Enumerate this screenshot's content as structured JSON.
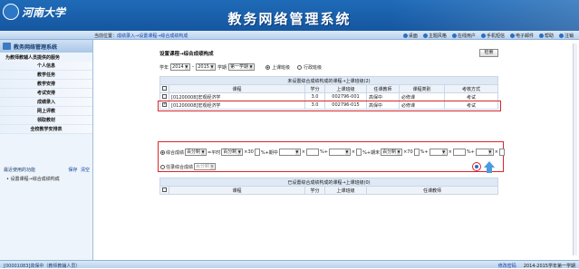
{
  "header": {
    "logo_text": "河南大学",
    "system_title": "教务网络管理系统"
  },
  "breadcrumb": {
    "prefix": "当前位置：",
    "path": "成绩录入→设置课程→综合成绩构成"
  },
  "top_menu": [
    {
      "label": "桌面",
      "icon": "desktop-icon"
    },
    {
      "label": "主题风格",
      "icon": "theme-icon"
    },
    {
      "label": "在线用户",
      "icon": "users-icon"
    },
    {
      "label": "手机短信",
      "icon": "phone-icon"
    },
    {
      "label": "电子邮件",
      "icon": "mail-icon"
    },
    {
      "label": "帮助",
      "icon": "help-icon"
    },
    {
      "label": "注销",
      "icon": "logout-icon"
    }
  ],
  "sidebar": {
    "title": "教务网络管理系统",
    "section": "为教师教辅人员提供的服务",
    "items": [
      {
        "label": "个人信息"
      },
      {
        "label": "教学任务"
      },
      {
        "label": "教学安排"
      },
      {
        "label": "考试安排"
      },
      {
        "label": "成绩录入"
      },
      {
        "label": "网上评教"
      },
      {
        "label": "领取教材"
      },
      {
        "label": "全校教学安排表"
      }
    ],
    "recent": {
      "title": "最近使用的功能",
      "save": "保存",
      "clear": "清空",
      "items": [
        "设置课程→综合成绩构成"
      ]
    }
  },
  "page": {
    "title": "设置课程→综合成绩构成",
    "search_button": "检索"
  },
  "filter": {
    "year_label": "学年",
    "year_from": "2014",
    "year_to": "2015",
    "term_label": "学期",
    "term_value": "第一学期",
    "radio_course": "上课班级",
    "radio_admin": "行政班级"
  },
  "unset_table": {
    "caption": "未设置综合成绩构成的课程→上课班级(2)",
    "headers": [
      "课程",
      "学分",
      "上课班级",
      "任课教师",
      "课程类别",
      "考核方式"
    ],
    "rows": [
      {
        "checked": false,
        "course": "[01200008]宏观经济学",
        "credit": "3.0",
        "class": "002796-001",
        "teacher": "高保中",
        "category": "必修课",
        "assess": "考试"
      },
      {
        "checked": true,
        "course": "[01200008]宏观经济学",
        "credit": "3.0",
        "class": "002796-015",
        "teacher": "高保中",
        "category": "必修课",
        "assess": "考试"
      }
    ]
  },
  "formula": {
    "radio_label": "综合成绩",
    "select_percent": "百分制",
    "eq_label": "=平时",
    "percent1": "百分制",
    "mult1": "×30",
    "plus_mid": "%+期中",
    "plus2": "%+",
    "plus_final": "%+期末",
    "percent_final": "百分制",
    "mult_final": "×70",
    "plus3": "%+",
    "plus4": "%+",
    "end_mult": "×",
    "other_label": "任录综合成绩",
    "other_select": "百分制"
  },
  "set_table": {
    "caption": "已设置综合成绩构成的课程→上课班级(0)",
    "headers": [
      "课程",
      "学分",
      "上课班级",
      "任课教师"
    ]
  },
  "status": {
    "user": "[00001083]高保中（教师教辅人员）",
    "link": "修改密码",
    "term": "2014-2015学年第一学期"
  },
  "colors": {
    "banner": "#1f6bb8",
    "highlight_box": "#d9262b"
  }
}
